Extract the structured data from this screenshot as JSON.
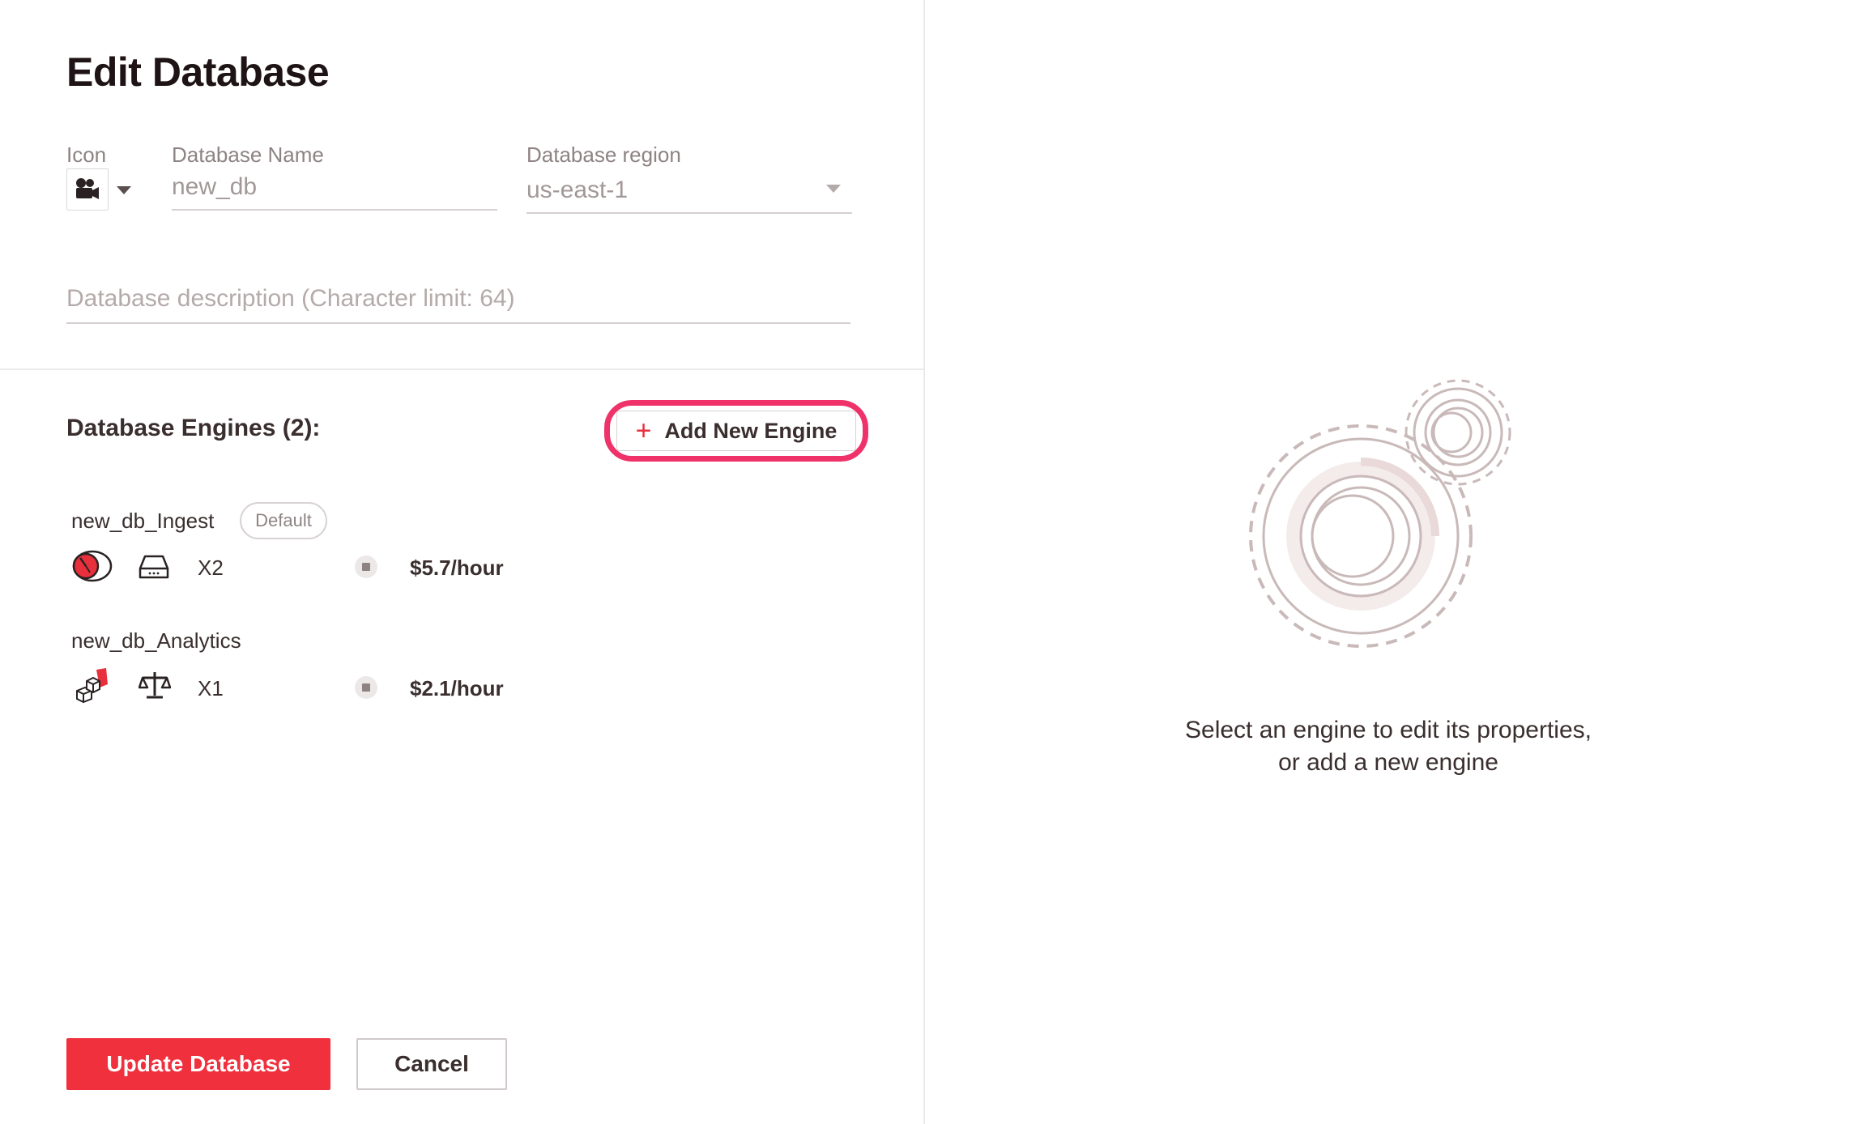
{
  "page": {
    "title": "Edit Database"
  },
  "form": {
    "icon_label": "Icon",
    "name_label": "Database Name",
    "name_value": "new_db",
    "region_label": "Database region",
    "region_value": "us-east-1",
    "description_placeholder": "Database description (Character limit: 64)"
  },
  "engines": {
    "title": "Database Engines (2):",
    "add_label": "Add New Engine",
    "items": [
      {
        "name": "new_db_Ingest",
        "badge": "Default",
        "scale": "X2",
        "price": "$5.7/hour",
        "type_icon": "speedometer-icon",
        "spec_icon": "storage-drive-icon"
      },
      {
        "name": "new_db_Analytics",
        "badge": "",
        "scale": "X1",
        "price": "$2.1/hour",
        "type_icon": "cubes-icon",
        "spec_icon": "balance-scale-icon"
      }
    ]
  },
  "actions": {
    "update_label": "Update Database",
    "cancel_label": "Cancel"
  },
  "empty_state": {
    "line1": "Select an engine to edit its properties,",
    "line2": "or add a new engine"
  },
  "colors": {
    "accent": "#f0303c",
    "highlight_ring": "#f0326a",
    "text": "#3a2e2e",
    "muted": "#8e8383"
  }
}
